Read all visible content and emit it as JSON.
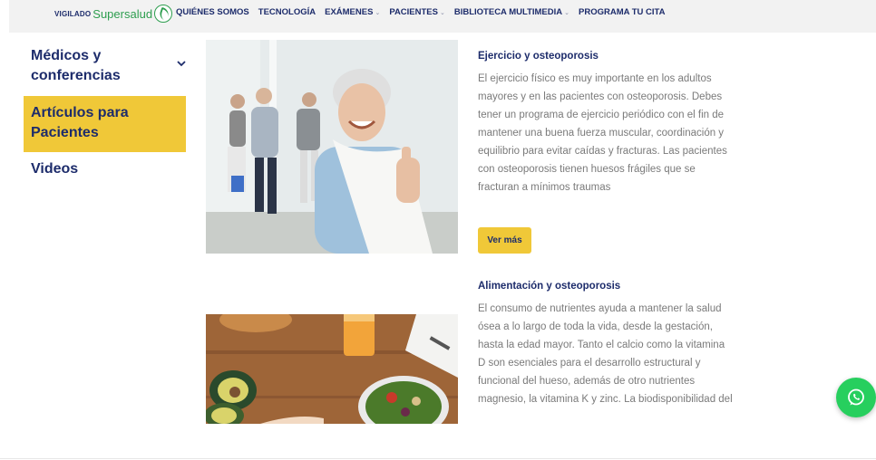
{
  "header": {
    "logo": {
      "prefix": "VIGILADO",
      "brand": "Supersalud"
    },
    "nav": [
      {
        "label": "QUIÉNES SOMOS",
        "has_dropdown": false
      },
      {
        "label": "TECNOLOGÍA",
        "has_dropdown": false
      },
      {
        "label": "EXÁMENES",
        "has_dropdown": true
      },
      {
        "label": "PACIENTES",
        "has_dropdown": true
      },
      {
        "label": "BIBLIOTECA MULTIMEDIA",
        "has_dropdown": true
      },
      {
        "label": "PROGRAMA TU CITA",
        "has_dropdown": false
      }
    ]
  },
  "sidebar": {
    "items": [
      {
        "label": "Médicos y conferencias",
        "icon": "chevron-down-icon",
        "active": false
      },
      {
        "label": "Artículos para Pacientes",
        "active": true
      },
      {
        "label": "Videos",
        "active": false
      }
    ]
  },
  "articles": [
    {
      "title": "Ejercicio y osteoporosis",
      "body": "El ejercicio físico es muy importante en los adultos mayores y en las pacientes con osteoporosis. Debes tener un programa de ejercicio periódico con el fin de mantener una buena fuerza muscular, coordinación y equilibrio para evitar caídas y fracturas. Las pacientes con osteoporosis tienen huesos frágiles que se fracturan a mínimos traumas",
      "button": "Ver más"
    },
    {
      "title": "Alimentación y osteoporosis",
      "body": "El consumo de nutrientes ayuda a mantener la salud ósea a lo largo de toda la vida, desde la gestación, hasta la edad mayor. Tanto el calcio como la vitamina D son esenciales para el desarrollo estructural y funcional del hueso, además de otro nutrientes magnesio, la vitamina K y zinc. La biodisponibilidad del"
    }
  ],
  "colors": {
    "navy": "#1d2c6b",
    "yellow": "#f0c838",
    "green": "#2e9e4f",
    "whatsapp": "#27cf5e"
  },
  "floating": {
    "icon": "whatsapp-icon"
  }
}
